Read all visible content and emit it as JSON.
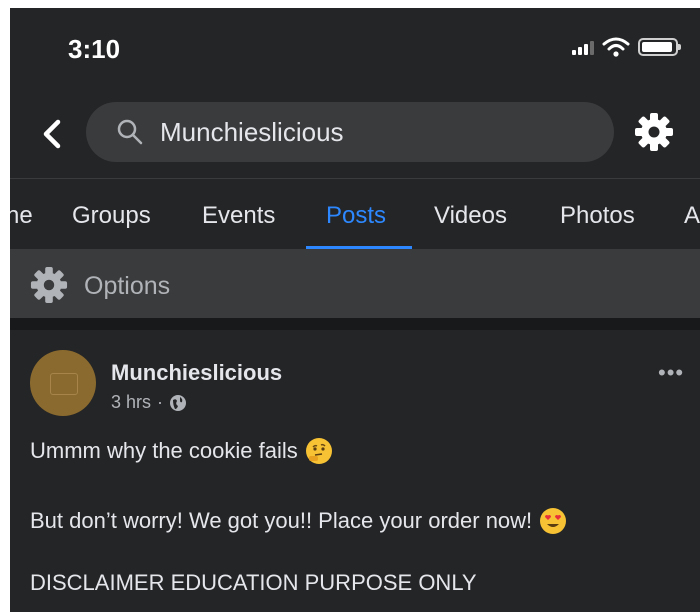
{
  "status_bar": {
    "time": "3:10"
  },
  "search": {
    "query": "Munchieslicious"
  },
  "tabs": [
    {
      "label": "ne"
    },
    {
      "label": "Groups"
    },
    {
      "label": "Events"
    },
    {
      "label": "Posts"
    },
    {
      "label": "Videos"
    },
    {
      "label": "Photos"
    },
    {
      "label": "A"
    }
  ],
  "active_tab": "Posts",
  "options": {
    "label": "Options"
  },
  "post": {
    "author": "Munchieslicious",
    "time": "3 hrs",
    "separator": "·",
    "more": "•••",
    "lines": [
      "Ummm why the cookie fails",
      "But don’t worry! We got you!! Place your order now!",
      "DISCLAIMER EDUCATION PURPOSE ONLY"
    ]
  },
  "colors": {
    "background": "#242526",
    "active_tab": "#2d88ff",
    "search_bg": "#3a3b3c",
    "avatar": "#8a6a2e"
  },
  "icons": [
    "signal-icon",
    "wifi-icon",
    "battery-icon",
    "back-arrow-icon",
    "search-icon",
    "gear-icon",
    "globe-icon",
    "thinking-face-emoji",
    "heart-eyes-emoji"
  ]
}
